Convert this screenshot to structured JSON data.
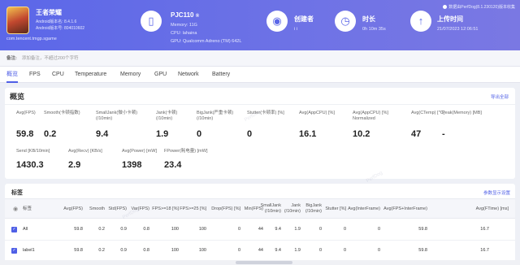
{
  "header": {
    "app_name": "王者荣耀",
    "android_version": "Android版本名: 8.4.1.6",
    "android_code": "Android版本号: 804010602",
    "package": "com.tencent.tmgp.sgame",
    "device_name": "PJC110",
    "device_badge": "®",
    "memory": "Memory: 11G",
    "cpu": "CPU: lahaina",
    "gpu": "GPU: Qualcomm Adreno (TM) 642L",
    "creator_label": "创建者",
    "creator_value": "i i",
    "duration_label": "时长",
    "duration_value": "0h 10m 35s",
    "upload_label": "上传时间",
    "upload_value": "21/07/2023 12:06:51",
    "tip": "数据由PerfDog(8.1.230120)版本收集"
  },
  "note": {
    "label": "备注:",
    "text": "添加备注，不超过200个字符"
  },
  "tabs": [
    "概览",
    "FPS",
    "CPU",
    "Temperature",
    "Memory",
    "GPU",
    "Network",
    "Battery"
  ],
  "overview": {
    "title": "概览",
    "export": "导出全部",
    "metrics_row1": [
      {
        "label": "Avg(FPS)",
        "value": "59.8"
      },
      {
        "label": "Smooth(卡顿指数)",
        "value": "0.2"
      },
      {
        "label": "SmallJank(微小卡顿)\n(/10min)",
        "value": "9.4"
      },
      {
        "label": "Jank(卡顿)\n(/10min)",
        "value": "1.9"
      },
      {
        "label": "BigJank(严重卡顿)\n(/10min)",
        "value": "0"
      },
      {
        "label": "Stutter(卡顿率) [%]",
        "value": "0"
      },
      {
        "label": "Avg(AppCPU) [%]",
        "value": "16.1"
      },
      {
        "label": "Avg(AppCPU) [%]\nNormalized",
        "value": "10.2"
      },
      {
        "label": "Avg(CTemp) [℃]",
        "value": "47"
      },
      {
        "label": "Peak(Memory) [MB]",
        "value": "-"
      }
    ],
    "metrics_row2": [
      {
        "label": "Send [KB/10min]",
        "value": "1430.3"
      },
      {
        "label": "Avg(Recv) [KB/s]",
        "value": "2.9"
      },
      {
        "label": "Avg(Power) [mW]",
        "value": "1398"
      },
      {
        "label": "FPower(耗电量) [mW]",
        "value": "23.4"
      }
    ]
  },
  "table": {
    "title": "标签",
    "settings": "参数显示设置",
    "headers": [
      "标签",
      "Avg(FPS)",
      "Smooth",
      "Std(FPS)",
      "Var(FPS)",
      "FPS>=18 [%]",
      "FPS>=25 [%]",
      "Drop(FPS) [%]",
      "Min(FPS)",
      "SmallJank\n(/10min)",
      "Jank\n(/10min)",
      "BigJank\n(/10min)",
      "Stutter [%]",
      "Avg(InterFrame)",
      "Avg(FPS+InterFrame)",
      "Avg(FTime) [ms]"
    ],
    "rows": [
      {
        "label": "All",
        "cells": [
          "59.8",
          "0.2",
          "0.9",
          "0.8",
          "100",
          "100",
          "0",
          "44",
          "9.4",
          "1.9",
          "0",
          "0",
          "0",
          "59.8",
          "16.7"
        ]
      },
      {
        "label": "label1",
        "cells": [
          "59.8",
          "0.2",
          "0.9",
          "0.8",
          "100",
          "100",
          "0",
          "44",
          "9.4",
          "1.9",
          "0",
          "0",
          "0",
          "59.8",
          "16.7"
        ]
      }
    ]
  },
  "watermark": "PerfDog",
  "colors": {
    "accent": "#4f5fe6",
    "header_from": "#5b67e8",
    "header_to": "#7a78e3"
  }
}
